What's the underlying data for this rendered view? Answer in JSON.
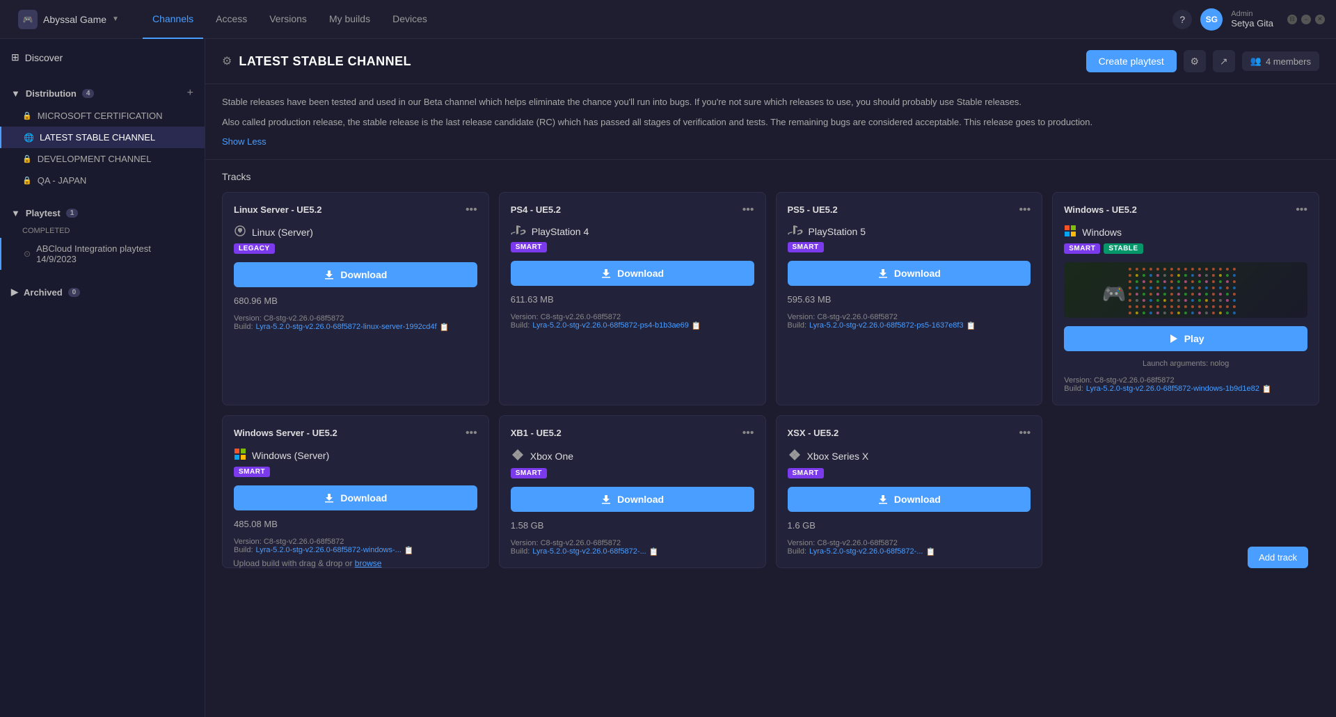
{
  "app": {
    "name": "Abyssal Game",
    "icon": "🎮"
  },
  "nav": {
    "tabs": [
      "Channels",
      "Access",
      "Versions",
      "My builds",
      "Devices"
    ],
    "active": "Channels"
  },
  "user": {
    "initials": "SG",
    "role": "Admin",
    "name": "Setya Gita"
  },
  "window_controls": {
    "restore": "⊞",
    "minimize": "−",
    "close": "✕"
  },
  "sidebar": {
    "discover_label": "Discover",
    "distribution_label": "Distribution",
    "distribution_count": "4",
    "playtest_label": "Playtest",
    "playtest_count": "1",
    "archived_label": "Archived",
    "archived_count": "0",
    "distribution_items": [
      {
        "label": "MICROSOFT CERTIFICATION",
        "icon": "🔒"
      },
      {
        "label": "LATEST STABLE CHANNEL",
        "icon": "🌐",
        "active": true
      },
      {
        "label": "DEVELOPMENT CHANNEL",
        "icon": "🔒"
      },
      {
        "label": "QA - JAPAN",
        "icon": "🔒"
      }
    ],
    "playtest_status": "COMPLETED",
    "playtest_item": "ABCloud Integration playtest 14/9/2023"
  },
  "channel": {
    "icon": "⚙",
    "title": "LATEST STABLE CHANNEL",
    "create_playtest_label": "Create playtest",
    "members_count": "4 members",
    "description_1": "Stable releases have been tested and used in our Beta channel which helps eliminate the chance you'll run into bugs. If you're not sure which releases to use, you should probably use Stable releases.",
    "description_2": "Also called production release, the stable release is the last release candidate (RC) which has passed all stages of verification and tests. The remaining bugs are considered acceptable. This release goes to production.",
    "show_less_label": "Show Less",
    "tracks_label": "Tracks"
  },
  "tracks": [
    {
      "id": "linux-server-ue52",
      "title": "Linux Server - UE5.2",
      "platform_icon": "🐧",
      "platform_name": "Linux (Server)",
      "tags": [
        "LEGACY"
      ],
      "tag_types": [
        "legacy"
      ],
      "action": "download",
      "action_label": "Download",
      "file_size": "680.96 MB",
      "version_label": "Version:",
      "version": "C8-stg-v2.26.0-68f5872",
      "build_label": "Build:",
      "build_link": "Lyra-5.2.0-stg-v2.26.0-68f5872-linux-server-1992cd4f",
      "thumbnail": null
    },
    {
      "id": "ps4-ue52",
      "title": "PS4 - UE5.2",
      "platform_icon": "🎮",
      "platform_name": "PlayStation 4",
      "tags": [
        "SMART"
      ],
      "tag_types": [
        "smart"
      ],
      "action": "download",
      "action_label": "Download",
      "file_size": "611.63 MB",
      "version_label": "Version:",
      "version": "C8-stg-v2.26.0-68f5872",
      "build_label": "Build:",
      "build_link": "Lyra-5.2.0-stg-v2.26.0-68f5872-ps4-b1b3ae69",
      "thumbnail": null
    },
    {
      "id": "ps5-ue52",
      "title": "PS5 - UE5.2",
      "platform_icon": "🎮",
      "platform_name": "PlayStation 5",
      "tags": [
        "SMART"
      ],
      "tag_types": [
        "smart"
      ],
      "action": "download",
      "action_label": "Download",
      "file_size": "595.63 MB",
      "version_label": "Version:",
      "version": "C8-stg-v2.26.0-68f5872",
      "build_label": "Build:",
      "build_link": "Lyra-5.2.0-stg-v2.26.0-68f5872-ps5-1637e8f3",
      "thumbnail": null
    },
    {
      "id": "windows-ue52",
      "title": "Windows - UE5.2",
      "platform_icon": "🪟",
      "platform_name": "Windows",
      "tags": [
        "SMART",
        "STABLE"
      ],
      "tag_types": [
        "smart",
        "stable"
      ],
      "action": "play",
      "action_label": "Play",
      "launch_args_label": "Launch arguments:",
      "launch_args": "nolog",
      "version_label": "Version:",
      "version": "C8-stg-v2.26.0-68f5872",
      "build_label": "Build:",
      "build_link": "Lyra-5.2.0-stg-v2.26.0-68f5872-windows-1b9d1e82",
      "has_thumbnail": true
    },
    {
      "id": "windows-server-ue52",
      "title": "Windows Server - UE5.2",
      "platform_icon": "🪟",
      "platform_name": "Windows (Server)",
      "tags": [
        "SMART"
      ],
      "tag_types": [
        "smart"
      ],
      "action": "download",
      "action_label": "Download",
      "file_size": "485.08 MB",
      "version_label": "Version:",
      "version": "C8-stg-v2.26.0-68f5872",
      "build_label": "Build:",
      "build_link": "Lyra-5.2.0-stg-v2.26.0-68f5872-windows-...",
      "thumbnail": null
    },
    {
      "id": "xb1-ue52",
      "title": "XB1 - UE5.2",
      "platform_icon": "🎮",
      "platform_name": "Xbox One",
      "tags": [
        "SMART"
      ],
      "tag_types": [
        "smart"
      ],
      "action": "download",
      "action_label": "Download",
      "file_size": "1.58 GB",
      "version_label": "Version:",
      "version": "C8-stg-v2.26.0-68f5872",
      "build_label": "Build:",
      "build_link": "Lyra-5.2.0-stg-v2.26.0-68f5872-...",
      "thumbnail": null
    },
    {
      "id": "xsx-ue52",
      "title": "XSX - UE5.2",
      "platform_icon": "✖",
      "platform_name": "Xbox Series X",
      "tags": [
        "SMART"
      ],
      "tag_types": [
        "smart"
      ],
      "action": "download",
      "action_label": "Download",
      "file_size": "1.6 GB",
      "version_label": "Version:",
      "version": "C8-stg-v2.26.0-68f5872",
      "build_label": "Build:",
      "build_link": "Lyra-5.2.0-stg-v2.26.0-68f5872-...",
      "thumbnail": null
    }
  ],
  "add_track_label": "Add track",
  "upload_hint": "Upload build with drag & drop or",
  "browse_label": "browse"
}
